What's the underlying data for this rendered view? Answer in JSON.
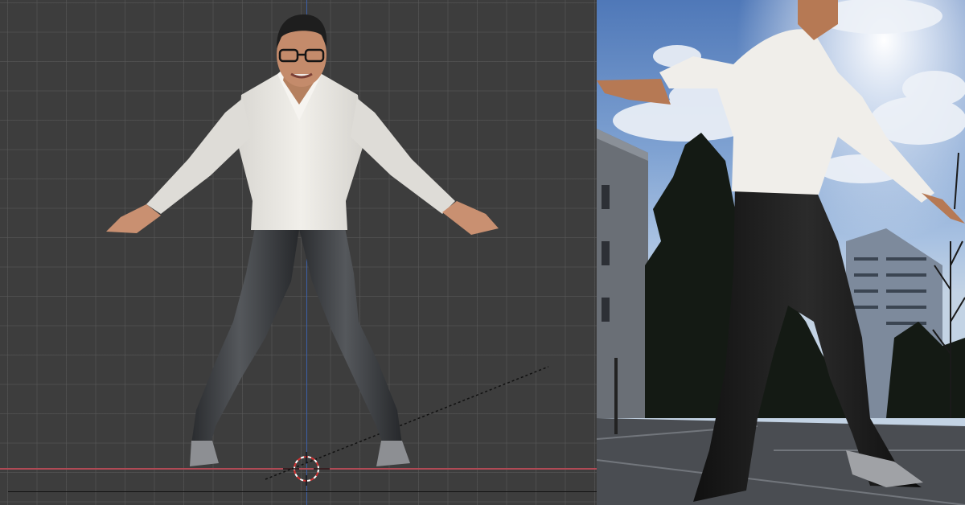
{
  "viewport": {
    "axis_colors": {
      "x": "#b04a55",
      "y": "#3b5fa8"
    },
    "grid_color": "#5a5a5a",
    "background": "#3d3d3d"
  },
  "character": {
    "shirt_color": "#e8e6e1",
    "pants_color": "#2f3134",
    "skin_color": "#c99071",
    "shoe_color": "#8d8f93"
  },
  "render": {
    "sky_color": "#6f95cc",
    "pavement_color": "#4a4d52"
  }
}
